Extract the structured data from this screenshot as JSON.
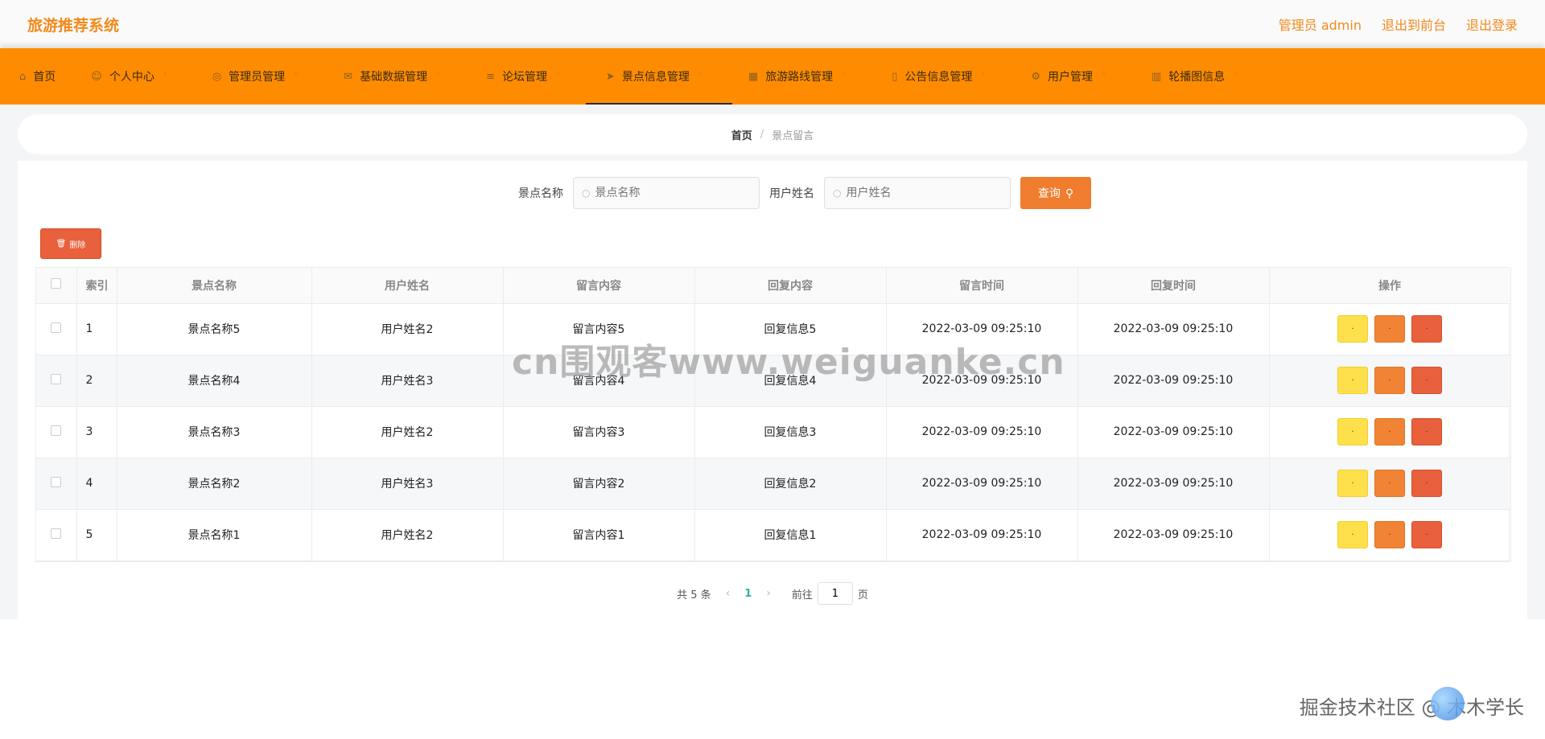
{
  "app": {
    "title": "旅游推荐系统",
    "top_links": [
      "管理员 admin",
      "退出到前台",
      "退出登录"
    ]
  },
  "nav": [
    {
      "label": "首页",
      "icon": "home-icon",
      "caret": false
    },
    {
      "label": "个人中心",
      "icon": "user-icon",
      "caret": true
    },
    {
      "label": "管理员管理",
      "icon": "compass-icon",
      "caret": true
    },
    {
      "label": "基础数据管理",
      "icon": "envelope-icon",
      "caret": true
    },
    {
      "label": "论坛管理",
      "icon": "list-icon",
      "caret": true
    },
    {
      "label": "景点信息管理",
      "icon": "plane-icon",
      "caret": true,
      "active": true
    },
    {
      "label": "旅游路线管理",
      "icon": "grid-icon",
      "caret": true
    },
    {
      "label": "公告信息管理",
      "icon": "doc-icon",
      "caret": true
    },
    {
      "label": "用户管理",
      "icon": "settings-icon",
      "caret": true
    },
    {
      "label": "轮播图信息",
      "icon": "building-icon",
      "caret": true
    }
  ],
  "breadcrumb": {
    "home": "首页",
    "separator": "/",
    "current": "景点留言"
  },
  "search": {
    "field1_label": "景点名称",
    "field1_placeholder": "景点名称",
    "field2_label": "用户姓名",
    "field2_placeholder": "用户姓名",
    "query_label": "查询"
  },
  "toolbar": {
    "delete_label": "删除"
  },
  "table": {
    "columns": [
      "索引",
      "景点名称",
      "用户姓名",
      "留言内容",
      "回复内容",
      "留言时间",
      "回复时间",
      "操作"
    ],
    "rows": [
      {
        "idx": "1",
        "spot": "景点名称5",
        "user": "用户姓名2",
        "content": "留言内容5",
        "reply": "回复信息5",
        "time": "2022-03-09 09:25:10",
        "reply_time": "2022-03-09 09:25:10"
      },
      {
        "idx": "2",
        "spot": "景点名称4",
        "user": "用户姓名3",
        "content": "留言内容4",
        "reply": "回复信息4",
        "time": "2022-03-09 09:25:10",
        "reply_time": "2022-03-09 09:25:10"
      },
      {
        "idx": "3",
        "spot": "景点名称3",
        "user": "用户姓名2",
        "content": "留言内容3",
        "reply": "回复信息3",
        "time": "2022-03-09 09:25:10",
        "reply_time": "2022-03-09 09:25:10"
      },
      {
        "idx": "4",
        "spot": "景点名称2",
        "user": "用户姓名3",
        "content": "留言内容2",
        "reply": "回复信息2",
        "time": "2022-03-09 09:25:10",
        "reply_time": "2022-03-09 09:25:10"
      },
      {
        "idx": "5",
        "spot": "景点名称1",
        "user": "用户姓名2",
        "content": "留言内容1",
        "reply": "回复信息1",
        "time": "2022-03-09 09:25:10",
        "reply_time": "2022-03-09 09:25:10"
      }
    ],
    "op_label": "·"
  },
  "pagination": {
    "total": "共 5 条",
    "current_page": "1",
    "goto_prefix": "前往",
    "goto_value": "1",
    "goto_suffix": "页"
  },
  "watermarks": {
    "center": "cn围观客www.weiguanke.cn",
    "corner": "掘金技术社区 @ 木木学长"
  },
  "colors": {
    "brand": "#f28a1c",
    "nav_bg": "#ff8c00",
    "query_btn": "#f07d2e",
    "delete_btn": "#e8603c",
    "view_btn": "#fde04c",
    "edit_btn": "#f08334",
    "page_active": "#2bb3a0"
  }
}
